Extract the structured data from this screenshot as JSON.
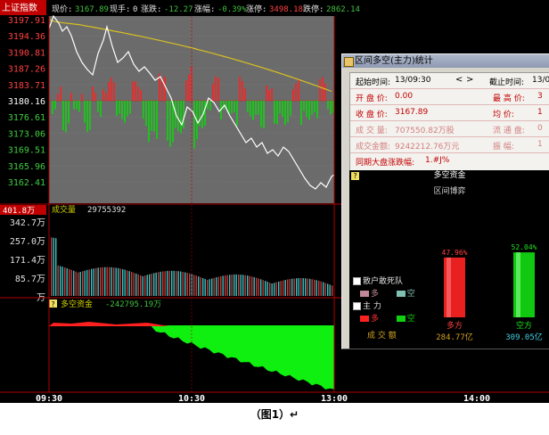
{
  "app": {
    "title": "上证指数"
  },
  "quote_bar": {
    "now_label": "现价:",
    "now_value": "3167.89",
    "hand_label": "现手:",
    "hand_value": "0",
    "chg_label": "涨跌:",
    "chg_value": "-12.27",
    "pct_label": "涨幅:",
    "pct_value": "-0.39%",
    "up_label": "涨停:",
    "up_value": "3498.18",
    "down_label": "跌停:",
    "down_value": "2862.14"
  },
  "price_axis": [
    "3197.91",
    "3194.36",
    "3190.81",
    "3187.26",
    "3183.71",
    "3180.16",
    "3176.61",
    "3173.06",
    "3169.51",
    "3165.96",
    "3162.41"
  ],
  "volume_panel": {
    "current_axis": "401.8万",
    "label": "成交量",
    "value": "29755392",
    "axis": [
      "342.7万",
      "257.0万",
      "171.4万",
      "85.7万",
      "万"
    ]
  },
  "fund_panel": {
    "label": "多空资金",
    "value": "-242795.19万"
  },
  "time_axis": [
    "09:30",
    "10:30",
    "13:00",
    "14:00"
  ],
  "popup": {
    "title": "区间多空(主力)统计",
    "start_time_label": "起始时间:",
    "start_time": "13/09:30",
    "end_time_label": "截止时间:",
    "end_time": "13/0",
    "nav_prev": "<",
    "nav_next": ">",
    "open_label": "开 盘 价:",
    "open_value": "0.00",
    "high_label": "最 高 价:",
    "high_value": "3",
    "close_label": "收 盘 价:",
    "close_value": "3167.89",
    "avg_label": "均    价:",
    "avg_value": "1",
    "volume_label": "成 交 量:",
    "volume_value": "707550.82万股",
    "float_label": "流 通 盘:",
    "float_value": "0",
    "amount_label": "成交金额:",
    "amount_value": "9242212.76万元",
    "amp_label": "振    幅:",
    "amp_value": "1",
    "index_label": "同期大盘涨跌幅:",
    "index_value": "1.#J%"
  },
  "fund_box": {
    "title": "多空资金",
    "subtitle": "区间博弈",
    "legend_retail": "散户敢死队",
    "legend_main": "主    力",
    "legend_long": "多",
    "legend_short": "空",
    "bull_pct": "47.96%",
    "bear_pct": "52.04%",
    "bull_label": "多方",
    "bear_label": "空方",
    "bull_amount": "284.77亿",
    "bear_amount": "309.05亿",
    "deal_label": "成    交    额"
  },
  "caption": "（图1）↵",
  "colors": {
    "up": "#ff3030",
    "down": "#20d020",
    "price_line": "#ffffff",
    "avg_line": "#d8c020",
    "bg": "#000000",
    "chart_bg": "#6b6b6b"
  }
}
